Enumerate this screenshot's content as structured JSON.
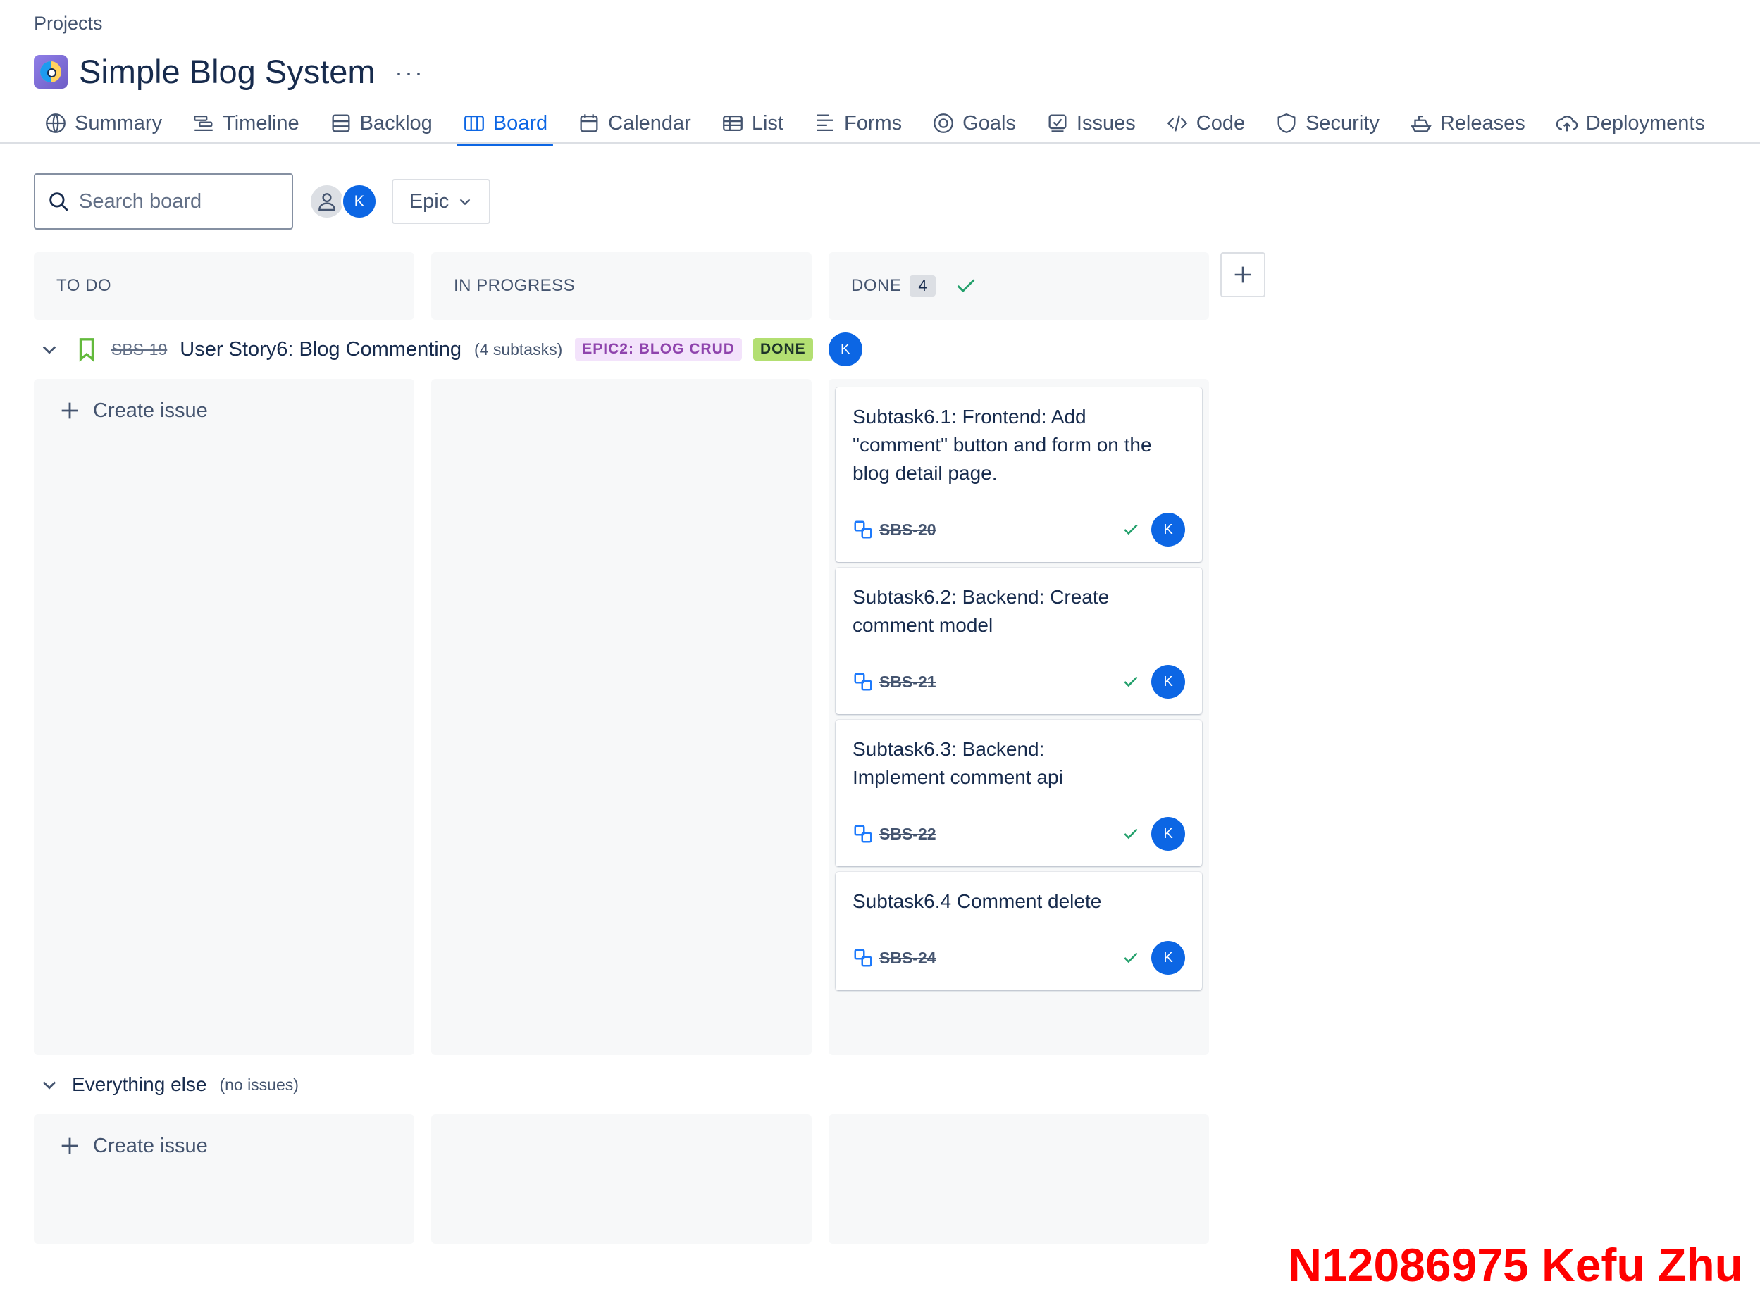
{
  "breadcrumb": "Projects",
  "project": {
    "title": "Simple Blog System",
    "more": "···"
  },
  "tabs": [
    {
      "label": "Summary",
      "icon": "globe-icon"
    },
    {
      "label": "Timeline",
      "icon": "timeline-icon"
    },
    {
      "label": "Backlog",
      "icon": "backlog-icon"
    },
    {
      "label": "Board",
      "icon": "board-icon",
      "active": true
    },
    {
      "label": "Calendar",
      "icon": "calendar-icon"
    },
    {
      "label": "List",
      "icon": "list-icon"
    },
    {
      "label": "Forms",
      "icon": "forms-icon"
    },
    {
      "label": "Goals",
      "icon": "goals-icon"
    },
    {
      "label": "Issues",
      "icon": "issues-icon"
    },
    {
      "label": "Code",
      "icon": "code-icon"
    },
    {
      "label": "Security",
      "icon": "shield-icon"
    },
    {
      "label": "Releases",
      "icon": "ship-icon"
    },
    {
      "label": "Deployments",
      "icon": "cloud-upload-icon"
    }
  ],
  "toolbar": {
    "search_placeholder": "Search board",
    "avatar_initial": "K",
    "epic_label": "Epic"
  },
  "columns": {
    "todo": "TO DO",
    "in_progress": "IN PROGRESS",
    "done": "DONE",
    "done_count": "4"
  },
  "swimlane": {
    "key": "SBS-19",
    "title": "User Story6: Blog Commenting",
    "subtask_count": "(4 subtasks)",
    "epic": "EPIC2: BLOG CRUD",
    "status": "DONE",
    "assignee": "K"
  },
  "create_issue": "Create issue",
  "cards": [
    {
      "title": "Subtask6.1: Frontend: Add \"comment\" button and form on the blog detail page.",
      "key": "SBS-20",
      "assignee": "K"
    },
    {
      "title": "Subtask6.2: Backend: Create comment model",
      "key": "SBS-21",
      "assignee": "K"
    },
    {
      "title": "Subtask6.3: Backend: Implement comment api",
      "key": "SBS-22",
      "assignee": "K"
    },
    {
      "title": "Subtask6.4 Comment delete",
      "key": "SBS-24",
      "assignee": "K"
    }
  ],
  "everything_else": {
    "label": "Everything else",
    "sub": "(no issues)"
  },
  "watermark": "N12086975 Kefu Zhu",
  "colors": {
    "accent": "#0c66e4",
    "watermark": "#ff0000",
    "done_lozenge": "#b3df72",
    "epic_lozenge": "#f3e3fb"
  }
}
